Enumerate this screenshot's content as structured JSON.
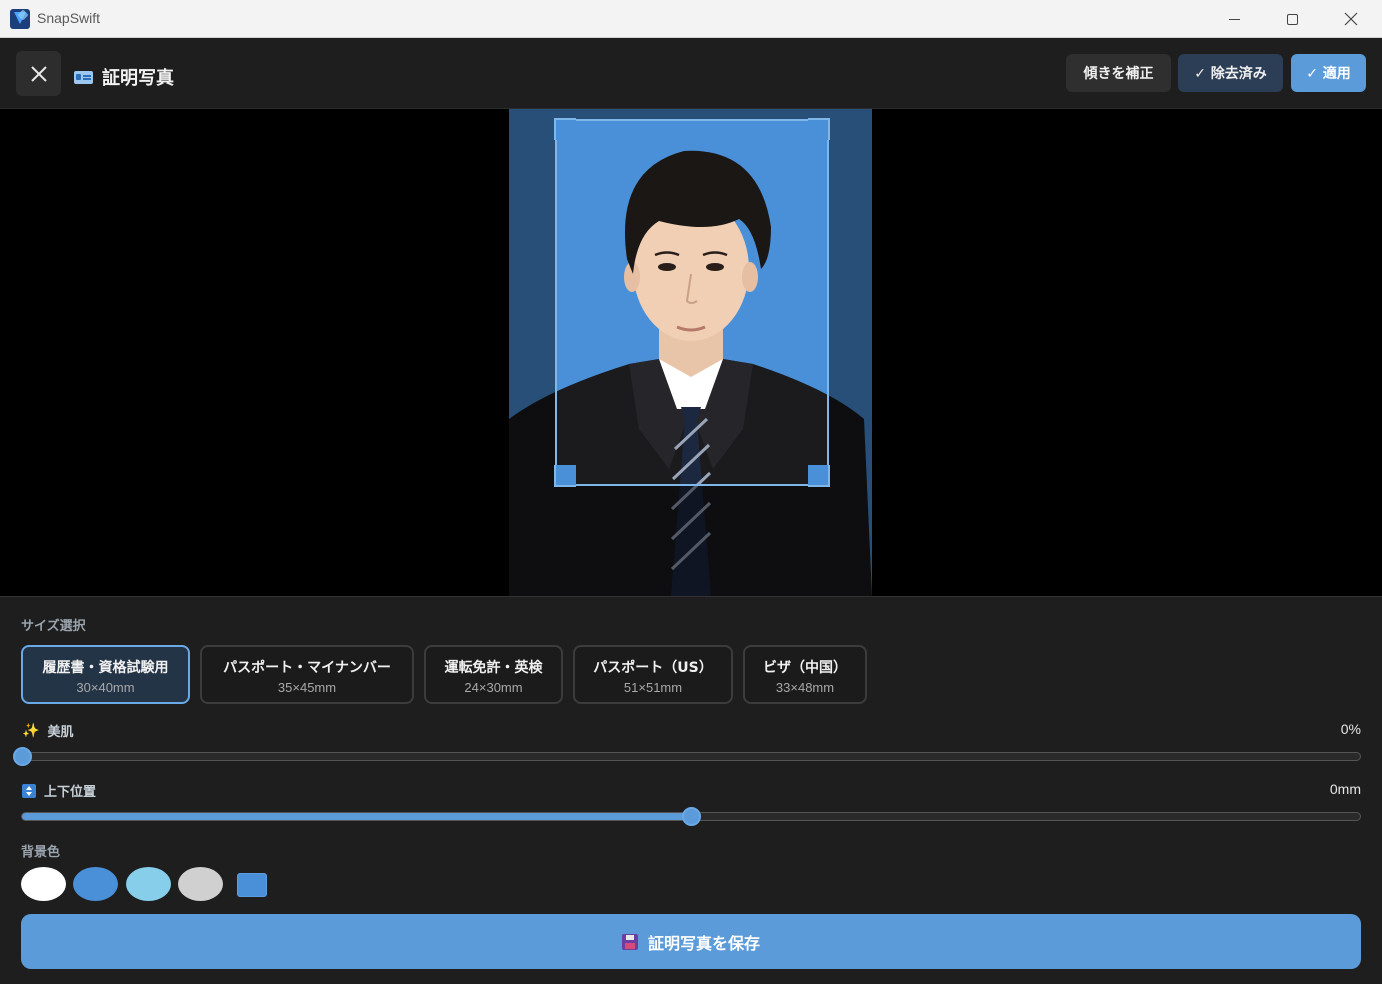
{
  "window": {
    "app_title": "SnapSwift",
    "icon": "snapswift-logo"
  },
  "header": {
    "title": "証明写真",
    "title_icon": "id-card-icon",
    "close_icon": "close-icon",
    "tilt_label": "傾きを補正",
    "removed_label": "✓ 除去済み",
    "apply_label": "✓ 適用"
  },
  "sizes": {
    "section_label": "サイズ選択",
    "selected_index": 0,
    "items": [
      {
        "name": "履歴書・資格試験用",
        "dim": "30×40mm"
      },
      {
        "name": "パスポート・マイナンバー",
        "dim": "35×45mm"
      },
      {
        "name": "運転免許・英検",
        "dim": "24×30mm"
      },
      {
        "name": "パスポート（US）",
        "dim": "51×51mm"
      },
      {
        "name": "ビザ（中国）",
        "dim": "33×48mm"
      }
    ]
  },
  "skin": {
    "label": "美肌",
    "icon": "sparkles-icon",
    "value_text": "0%",
    "level": 0
  },
  "position": {
    "label": "上下位置",
    "icon": "up-down-arrow-icon",
    "value_text": "0mm",
    "level": 0.5
  },
  "background": {
    "label": "背景色",
    "colors": [
      "#ffffff",
      "#4a90d9",
      "#87ceeb",
      "#d0d0d0"
    ],
    "custom_color": "#4a90d9"
  },
  "save": {
    "label": "証明写真を保存",
    "icon": "floppy-disk-icon"
  },
  "colors": {
    "accent": "#5b9bd9",
    "photo_background": "#4a90d9"
  }
}
